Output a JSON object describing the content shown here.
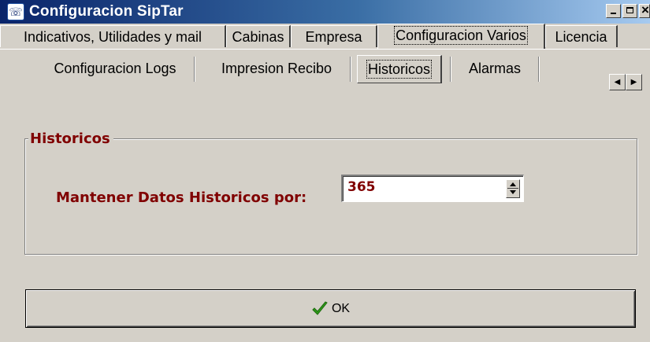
{
  "window": {
    "title": "Configuracion SipTar",
    "icon": "telephone-icon"
  },
  "main_tabs": [
    {
      "label": "Indicativos, Utilidades y mail"
    },
    {
      "label": "Cabinas"
    },
    {
      "label": "Empresa"
    },
    {
      "label": "Configuracion Varios",
      "active": true
    },
    {
      "label": "Licencia"
    }
  ],
  "sub_tabs": [
    {
      "label": "Configuracion Logs"
    },
    {
      "label": "Impresion Recibo"
    },
    {
      "label": "Historicos",
      "active": true
    },
    {
      "label": "Alarmas"
    }
  ],
  "group": {
    "title": "Historicos",
    "field_label": "Mantener Datos Historicos por:",
    "field_value": "365"
  },
  "ok_button": {
    "label": "OK",
    "icon": "checkmark-icon"
  },
  "colors": {
    "accent_text": "#800000",
    "titlebar": "#0a246a",
    "face": "#d4d0c8"
  }
}
